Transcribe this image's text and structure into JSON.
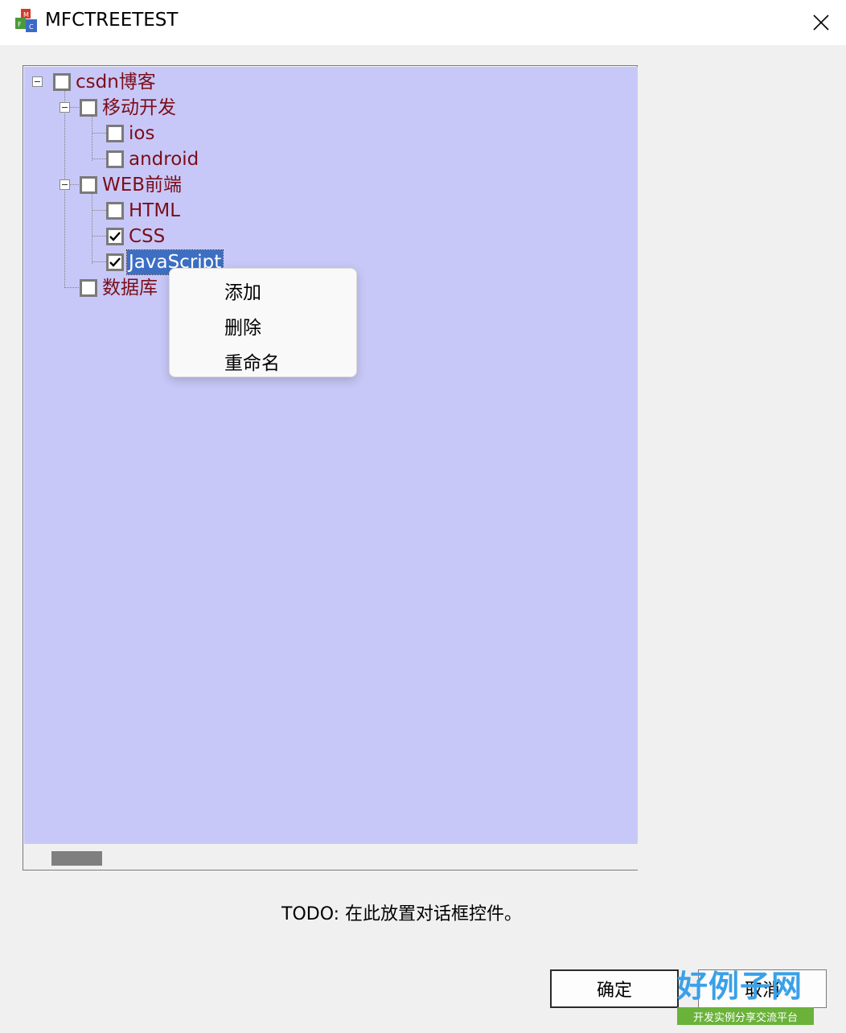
{
  "window": {
    "title": "MFCTREETEST"
  },
  "tree": {
    "items": [
      {
        "label": "csdn博客",
        "checked": false
      },
      {
        "label": "移动开发",
        "checked": false
      },
      {
        "label": "ios",
        "checked": false
      },
      {
        "label": "android",
        "checked": false
      },
      {
        "label": "WEB前端",
        "checked": false
      },
      {
        "label": "HTML",
        "checked": false
      },
      {
        "label": "CSS",
        "checked": true
      },
      {
        "label": "JavaScript",
        "checked": true,
        "selected": true
      },
      {
        "label": "数据库",
        "checked": false
      }
    ]
  },
  "context_menu": {
    "items": [
      "添加",
      "删除",
      "重命名"
    ]
  },
  "footer": {
    "todo_text": "TODO:  在此放置对话框控件。",
    "ok_label": "确定",
    "cancel_label": "取消"
  },
  "watermark": {
    "brand": "好例子网",
    "tagline": "开发实例分享交流平台"
  },
  "colors": {
    "tree_bg": "#c8c8f8",
    "item_text": "#7b0e1a",
    "selection": "#3c6fc4"
  }
}
